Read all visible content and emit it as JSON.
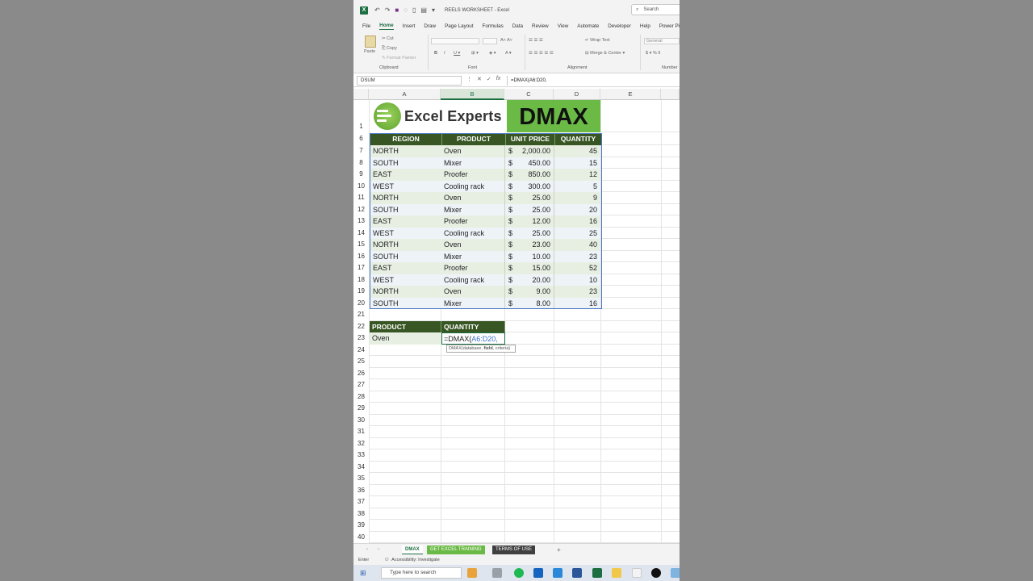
{
  "window": {
    "title": "REELS WORKSHEET - Excel",
    "search_label": "Search"
  },
  "menu_tabs": [
    "File",
    "Home",
    "Insert",
    "Draw",
    "Page Layout",
    "Formulas",
    "Data",
    "Review",
    "View",
    "Automate",
    "Developer",
    "Help",
    "Power Pi"
  ],
  "active_tab": "Home",
  "ribbon": {
    "paste": "Paste",
    "cut": "Cut",
    "copy": "Copy",
    "format_painter": "Format Painter",
    "clipboard": "Clipboard",
    "font": "Font",
    "alignment": "Alignment",
    "wrap_text": "Wrap Text",
    "merge_center": "Merge & Center",
    "number_format": "General",
    "number": "Number"
  },
  "formula_bar": {
    "name_box": "DSUM",
    "formula": "=DMAX(A6:D20,"
  },
  "columns": [
    "A",
    "B",
    "C",
    "D",
    "E"
  ],
  "banner": {
    "logo_text": "Excel Experts",
    "title": "DMAX"
  },
  "table": {
    "headers": [
      "REGION",
      "PRODUCT",
      "UNIT PRICE",
      "QUANTITY"
    ],
    "currency": "$",
    "rows": [
      {
        "row": "7",
        "region": "NORTH",
        "product": "Oven",
        "price": "2,000.00",
        "qty": "45"
      },
      {
        "row": "8",
        "region": "SOUTH",
        "product": "Mixer",
        "price": "450.00",
        "qty": "15"
      },
      {
        "row": "9",
        "region": "EAST",
        "product": "Proofer",
        "price": "850.00",
        "qty": "12"
      },
      {
        "row": "10",
        "region": "WEST",
        "product": "Cooling rack",
        "price": "300.00",
        "qty": "5"
      },
      {
        "row": "11",
        "region": "NORTH",
        "product": "Oven",
        "price": "25.00",
        "qty": "9"
      },
      {
        "row": "12",
        "region": "SOUTH",
        "product": "Mixer",
        "price": "25.00",
        "qty": "20"
      },
      {
        "row": "13",
        "region": "EAST",
        "product": "Proofer",
        "price": "12.00",
        "qty": "16"
      },
      {
        "row": "14",
        "region": "WEST",
        "product": "Cooling rack",
        "price": "25.00",
        "qty": "25"
      },
      {
        "row": "15",
        "region": "NORTH",
        "product": "Oven",
        "price": "23.00",
        "qty": "40"
      },
      {
        "row": "16",
        "region": "SOUTH",
        "product": "Mixer",
        "price": "10.00",
        "qty": "23"
      },
      {
        "row": "17",
        "region": "EAST",
        "product": "Proofer",
        "price": "15.00",
        "qty": "52"
      },
      {
        "row": "18",
        "region": "WEST",
        "product": "Cooling rack",
        "price": "20.00",
        "qty": "10"
      },
      {
        "row": "19",
        "region": "NORTH",
        "product": "Oven",
        "price": "9.00",
        "qty": "23"
      },
      {
        "row": "20",
        "region": "SOUTH",
        "product": "Mixer",
        "price": "8.00",
        "qty": "16"
      }
    ]
  },
  "criteria": {
    "headers": [
      "PRODUCT",
      "QUANTITY"
    ],
    "product": "Oven",
    "formula_prefix": "=DMAX(",
    "formula_ref": "A6:D20,",
    "tooltip_prefix": "DMAX(database, ",
    "tooltip_bold": "field",
    "tooltip_suffix": ", criteria)"
  },
  "row_numbers_top": [
    "1",
    "6"
  ],
  "row_numbers_after": [
    "21",
    "22",
    "23",
    "24",
    "25",
    "26",
    "27",
    "28",
    "29",
    "30",
    "31",
    "32",
    "33",
    "34",
    "35",
    "36",
    "37",
    "38",
    "39",
    "40"
  ],
  "sheet_tabs": {
    "active": "DMAX",
    "training": "GET EXCEL TRAINING",
    "terms": "TERMS OF USE",
    "add": "+"
  },
  "status": {
    "mode": "Enter",
    "accessibility": "Accessibility: Investigate"
  },
  "taskbar": {
    "search_placeholder": "Type here to search"
  },
  "colors": {
    "header_green": "#375623",
    "banner_green": "#6bba46",
    "excel_green": "#1d6f42"
  }
}
